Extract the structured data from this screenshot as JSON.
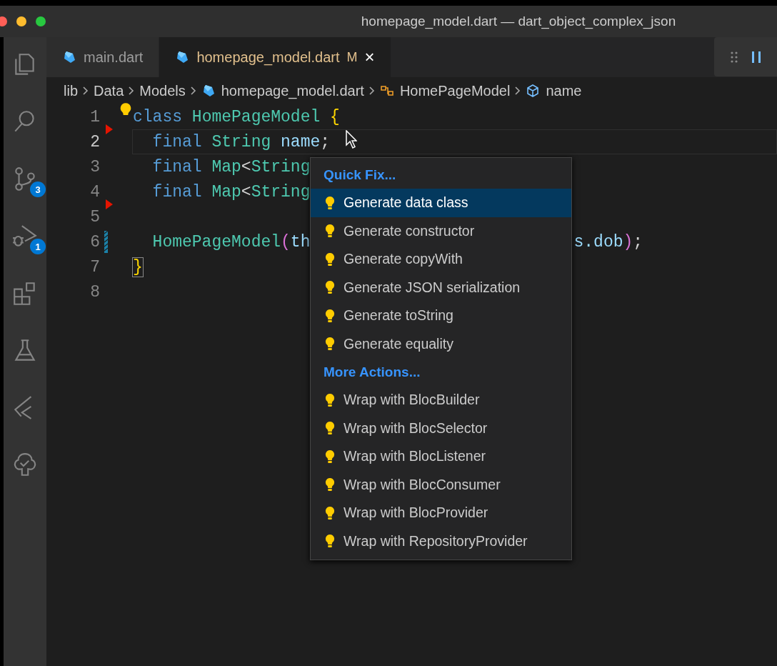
{
  "window": {
    "title": "homepage_model.dart — dart_object_complex_json"
  },
  "activity_bar": [
    {
      "kind": "files"
    },
    {
      "kind": "search"
    },
    {
      "kind": "source-control",
      "badge": "3"
    },
    {
      "kind": "debug",
      "badge": "1"
    },
    {
      "kind": "extensions"
    },
    {
      "kind": "testing"
    },
    {
      "kind": "flutter"
    },
    {
      "kind": "tree-check"
    }
  ],
  "tabs": [
    {
      "label": "main.dart",
      "selected": false
    },
    {
      "label": "homepage_model.dart",
      "selected": true,
      "status": "M",
      "close": "×"
    }
  ],
  "breadcrumbs": [
    {
      "label": "lib",
      "kind": "folder"
    },
    {
      "label": "Data",
      "kind": "folder"
    },
    {
      "label": "Models",
      "kind": "folder"
    },
    {
      "label": "homepage_model.dart",
      "kind": "file"
    },
    {
      "label": "HomePageModel",
      "kind": "class"
    },
    {
      "label": "name",
      "kind": "field"
    }
  ],
  "editor": {
    "lines": [
      {
        "number": "1",
        "current": false,
        "lightbulb": true,
        "tokens": [
          {
            "text": "class ",
            "kind": "keyword"
          },
          {
            "text": "HomePageModel ",
            "kind": "type"
          },
          {
            "text": "{",
            "kind": "brace"
          }
        ]
      },
      {
        "number": "2",
        "current": true,
        "deleted_marker": true,
        "tokens": [
          {
            "text": "  final ",
            "kind": "keyword"
          },
          {
            "text": "String ",
            "kind": "type"
          },
          {
            "text": "name",
            "kind": "ident"
          },
          {
            "text": ";",
            "kind": "punct"
          }
        ]
      },
      {
        "number": "3",
        "current": false,
        "tokens": [
          {
            "text": "  final ",
            "kind": "keyword"
          },
          {
            "text": "Map",
            "kind": "type"
          },
          {
            "text": "<",
            "kind": "punct"
          },
          {
            "text": "String",
            "kind": "type"
          }
        ]
      },
      {
        "number": "4",
        "current": false,
        "tokens": [
          {
            "text": "  final ",
            "kind": "keyword"
          },
          {
            "text": "Map",
            "kind": "type"
          },
          {
            "text": "<",
            "kind": "punct"
          },
          {
            "text": "String",
            "kind": "type"
          }
        ]
      },
      {
        "number": "5",
        "current": false,
        "deleted_marker": true
      },
      {
        "number": "6",
        "current": false,
        "modified": true,
        "tokens": [
          {
            "text": "  HomePageModel",
            "kind": "type"
          },
          {
            "text": "(",
            "kind": "paren"
          },
          {
            "text": "th",
            "kind": "ident"
          },
          {
            "text": "s",
            "kind": "gap"
          },
          {
            "text": ".dob",
            "kind": "ident"
          },
          {
            "text": ")",
            "kind": "paren"
          },
          {
            "text": ";",
            "kind": "punct"
          }
        ]
      },
      {
        "number": "7",
        "current": false,
        "tokens": [
          {
            "text": "}",
            "kind": "brace-match"
          }
        ]
      },
      {
        "number": "8",
        "current": false
      }
    ]
  },
  "quick_fix": {
    "sections": [
      {
        "title": "Quick Fix...",
        "items": [
          {
            "label": "Generate data class",
            "selected": true
          },
          {
            "label": "Generate constructor",
            "selected": false
          },
          {
            "label": "Generate copyWith",
            "selected": false
          },
          {
            "label": "Generate JSON serialization",
            "selected": false
          },
          {
            "label": "Generate toString",
            "selected": false
          },
          {
            "label": "Generate equality",
            "selected": false
          }
        ]
      },
      {
        "title": "More Actions...",
        "items": [
          {
            "label": "Wrap with BlocBuilder",
            "selected": false
          },
          {
            "label": "Wrap with BlocSelector",
            "selected": false
          },
          {
            "label": "Wrap with BlocListener",
            "selected": false
          },
          {
            "label": "Wrap with BlocConsumer",
            "selected": false
          },
          {
            "label": "Wrap with BlocProvider",
            "selected": false
          },
          {
            "label": "Wrap with RepositoryProvider",
            "selected": false
          }
        ]
      }
    ]
  }
}
